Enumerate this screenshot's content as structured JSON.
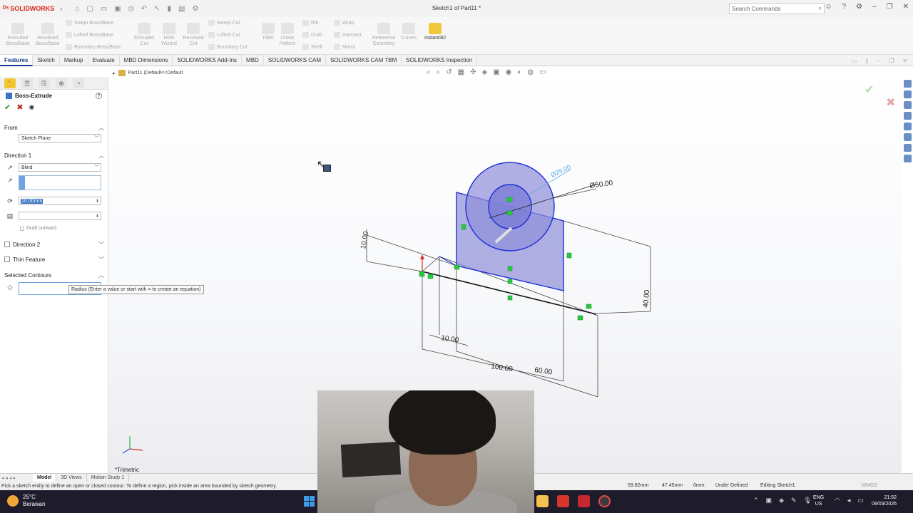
{
  "app": {
    "brand": "SOLIDWORKS",
    "window_title": "Sketch1 of Part11 *",
    "search_placeholder": "Search Commands"
  },
  "commands": {
    "extruded_boss": "Extruded Boss/Base",
    "revolved_boss": "Revolved Boss/Base",
    "swept_boss": "Swept Boss/Base",
    "lofted_boss": "Lofted Boss/Base",
    "boundary_boss": "Boundary Boss/Base",
    "extruded_cut": "Extruded Cut",
    "hole_wizard": "Hole Wizard",
    "revolved_cut": "Revolved Cut",
    "swept_cut": "Swept Cut",
    "lofted_cut": "Lofted Cut",
    "boundary_cut": "Boundary Cut",
    "fillet": "Fillet",
    "linear_pattern": "Linear Pattern",
    "rib": "Rib",
    "draft": "Draft",
    "shell": "Shell",
    "wrap": "Wrap",
    "intersect": "Intersect",
    "mirror": "Mirror",
    "reference_geometry": "Reference Geometry",
    "curves": "Curves",
    "instant3d": "Instant3D"
  },
  "tabs": [
    "Features",
    "Sketch",
    "Markup",
    "Evaluate",
    "MBD Dimensions",
    "SOLIDWORKS Add-Ins",
    "MBD",
    "SOLIDWORKS CAM",
    "SOLIDWORKS CAM TBM",
    "SOLIDWORKS Inspection"
  ],
  "tree": {
    "crumb": "Part11 (Default<<Default"
  },
  "property_manager": {
    "title": "Boss-Extrude",
    "from_label": "From",
    "from_value": "Sketch Plane",
    "direction1_label": "Direction 1",
    "end_condition": "Blind",
    "depth": "10.00mm",
    "draft_outward": "Draft outward",
    "direction2_label": "Direction 2",
    "thin_feature_label": "Thin Feature",
    "selected_contours_label": "Selected Contours",
    "tooltip": "Radius (Enter a value or start with = to create an equation)"
  },
  "viewport": {
    "view_name": "*Trimetric",
    "dimensions": {
      "d25": "Ø25.00",
      "d50": "Ø50.00",
      "h10": "10.00",
      "h40": "40.00",
      "w10": "10.00",
      "w100": "100.00",
      "w60": "60.00"
    }
  },
  "model_tabs": [
    "Model",
    "3D Views",
    "Motion Study 1"
  ],
  "status": {
    "message": "Pick a sketch entity to define an open or closed contour. To define a region, pick inside an area bounded by sketch geometry.",
    "x": "59.82mm",
    "y": "47.45mm",
    "z": "0mm",
    "state": "Under Defined",
    "editing": "Editing Sketch1",
    "units": "MMGS"
  },
  "taskbar": {
    "temp": "25°C",
    "weather": "Berawan",
    "lang_top": "ENG",
    "lang_bottom": "US",
    "time": "21:52",
    "date": "09/03/2026"
  },
  "colors": {
    "accent": "#1a3e8c",
    "sketch_blue": "#1c2fd9",
    "face_fill": "#8e8fd9",
    "relation_green": "#27c93f",
    "brand_red": "#d9261c"
  }
}
